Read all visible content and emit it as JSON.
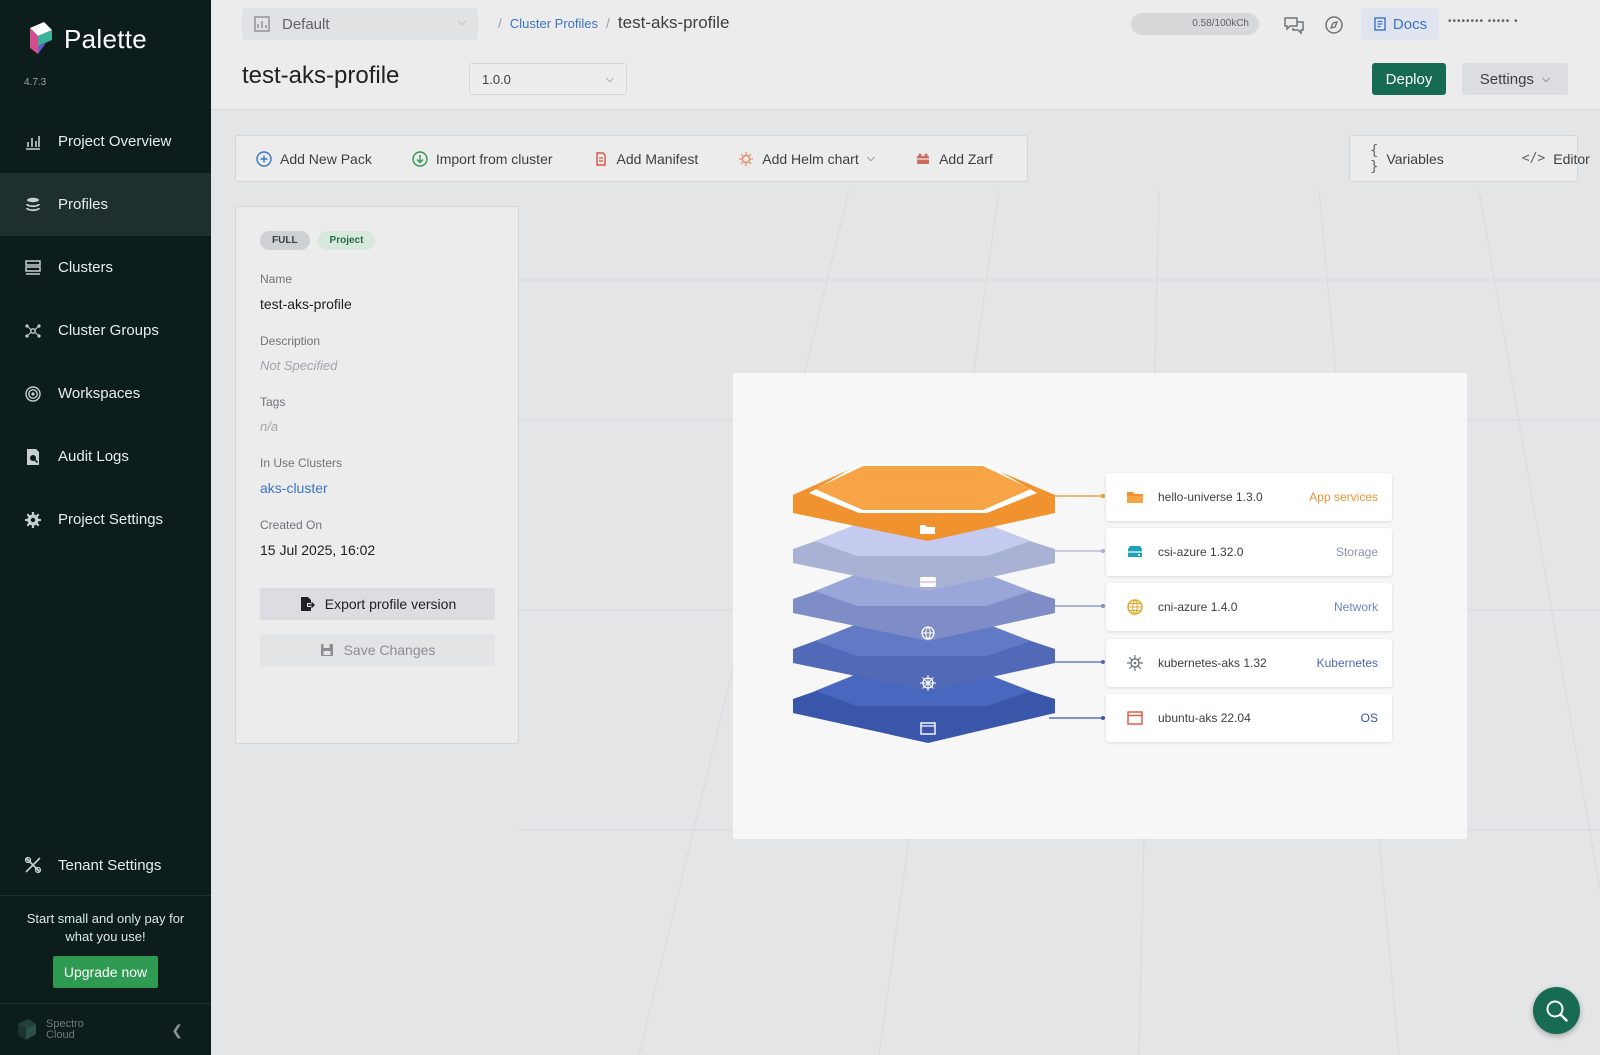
{
  "app": {
    "name": "Palette",
    "version": "4.7.3"
  },
  "sidebar": {
    "items": [
      {
        "label": "Project Overview",
        "icon": "chart-icon",
        "active": false
      },
      {
        "label": "Profiles",
        "icon": "layers-icon",
        "active": true
      },
      {
        "label": "Clusters",
        "icon": "servers-icon",
        "active": false
      },
      {
        "label": "Cluster Groups",
        "icon": "nodes-icon",
        "active": false
      },
      {
        "label": "Workspaces",
        "icon": "target-icon",
        "active": false
      },
      {
        "label": "Audit Logs",
        "icon": "audit-icon",
        "active": false
      },
      {
        "label": "Project Settings",
        "icon": "gear-icon",
        "active": false
      }
    ],
    "tenant_settings": "Tenant Settings",
    "promo_text": "Start small and only pay for what you use!",
    "upgrade_label": "Upgrade now",
    "footer_brand_line1": "Spectro",
    "footer_brand_line2": "Cloud"
  },
  "header": {
    "project": "Default",
    "breadcrumb_link": "Cluster Profiles",
    "breadcrumb_current": "test-aks-profile",
    "usage": "0.58/100kCh",
    "docs_label": "Docs",
    "user": "•••••••• ••••• •"
  },
  "page": {
    "title": "test-aks-profile",
    "version": "1.0.0",
    "deploy_label": "Deploy",
    "settings_label": "Settings"
  },
  "toolbar": {
    "add_pack": "Add New Pack",
    "import_cluster": "Import from cluster",
    "add_manifest": "Add Manifest",
    "add_helm": "Add Helm chart",
    "add_zarf": "Add Zarf",
    "variables": "Variables",
    "editor": "Editor"
  },
  "details": {
    "badge_type": "FULL",
    "badge_scope": "Project",
    "name_label": "Name",
    "name_value": "test-aks-profile",
    "description_label": "Description",
    "description_value": "Not Specified",
    "tags_label": "Tags",
    "tags_value": "n/a",
    "clusters_label": "In Use Clusters",
    "clusters_value": "aks-cluster",
    "created_label": "Created On",
    "created_value": "15 Jul 2025, 16:02",
    "export_label": "Export profile version",
    "save_label": "Save Changes"
  },
  "layers": [
    {
      "name": "hello-universe 1.3.0",
      "type": "App services",
      "color": "#f0922e",
      "icon": "folder-icon"
    },
    {
      "name": "csi-azure 1.32.0",
      "type": "Storage",
      "color": "#8a94a8",
      "icon": "storage-icon"
    },
    {
      "name": "cni-azure 1.4.0",
      "type": "Network",
      "color": "#6c86c2",
      "icon": "globe-icon"
    },
    {
      "name": "kubernetes-aks 1.32",
      "type": "Kubernetes",
      "color": "#4b67b8",
      "icon": "helm-wheel-icon"
    },
    {
      "name": "ubuntu-aks 22.04",
      "type": "OS",
      "color": "#3552a8",
      "icon": "window-icon"
    }
  ]
}
